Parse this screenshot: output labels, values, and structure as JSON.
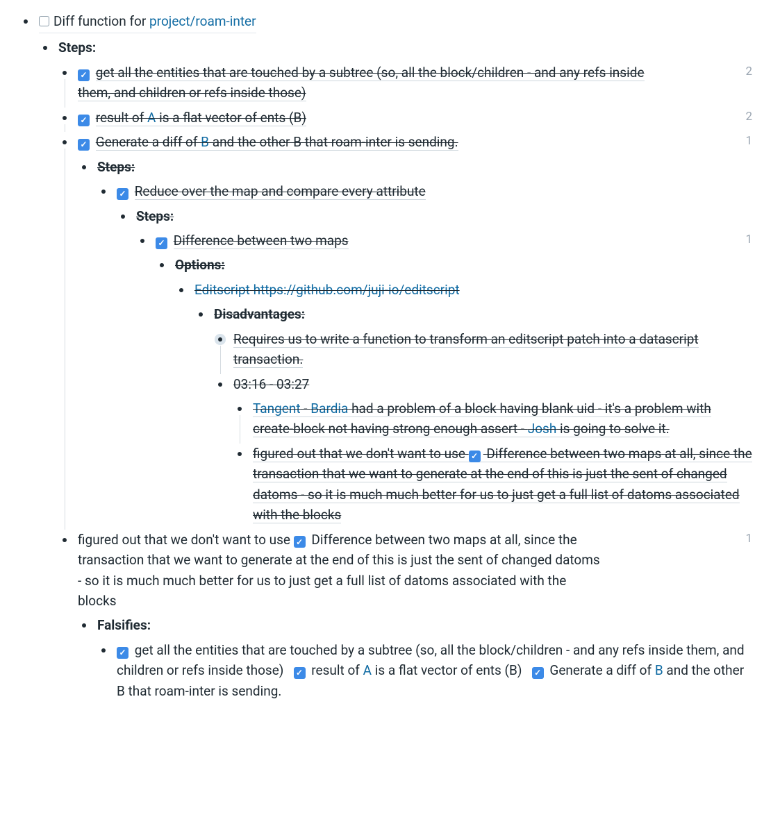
{
  "title": {
    "prefix": "Diff function for ",
    "link": "project/roam-inter"
  },
  "labels": {
    "steps": "Steps:",
    "options": "Options:",
    "disadvantages": "Disadvantages:",
    "falsifies": "Falsifies:"
  },
  "items": {
    "a": {
      "text": "get all the entities that are touched by a subtree (so, all the block/children - and any refs inside them, and children or refs inside those)",
      "count": "2"
    },
    "b": {
      "pre": "result of ",
      "link": "A",
      "post": " is a flat vector of ents (B)",
      "count": "2"
    },
    "c": {
      "pre": "Generate a diff of ",
      "link": "B",
      "post": " and the other B that roam-inter is sending.",
      "count": "1"
    },
    "reduce": "Reduce over the map and compare every attribute",
    "diffmaps": {
      "text": "Difference between two maps",
      "count": "1"
    },
    "editscript": {
      "label": "Editscript",
      "url": "https://github.com/juji-io/editscript"
    },
    "req": "Requires us to write a function to transform an editscript patch into a datascript transaction.",
    "time": "03:16 - 03:27",
    "tangent": {
      "tword": "Tangent",
      "sep1": " - ",
      "bardia": "Bardia",
      "mid": " had a problem of a block having blank uid - it's a problem with create-block not having strong enough assert - ",
      "josh": "Josh",
      "tail": " is going to solve it."
    },
    "figured": {
      "pre": "figured out that we don't want to use ",
      "ref": "Difference between two maps",
      "post": " at all, since the transaction that we want to generate at the end of this is just the sent of changed datoms - so it is much much better for us to just get a full list of datoms associated with the blocks"
    },
    "figured2": {
      "pre": "figured out that we don't want to use ",
      "ref": "Difference between two maps",
      "post": "  at all, since the transaction that we want to generate at the end of this is just the sent of changed datoms - so it is much much better for us to just get a full list of datoms associated with the blocks",
      "count": "1"
    },
    "falsify": {
      "a": "get all the entities that are touched by a subtree (so, all the block/children - and any refs inside them, and children or refs inside those)",
      "b_pre": "result of ",
      "b_link": "A",
      "b_post": " is a flat vector of ents (B)",
      "c_pre": "Generate a diff of ",
      "c_link": "B",
      "c_post": " and the other B that roam-inter is sending."
    }
  }
}
